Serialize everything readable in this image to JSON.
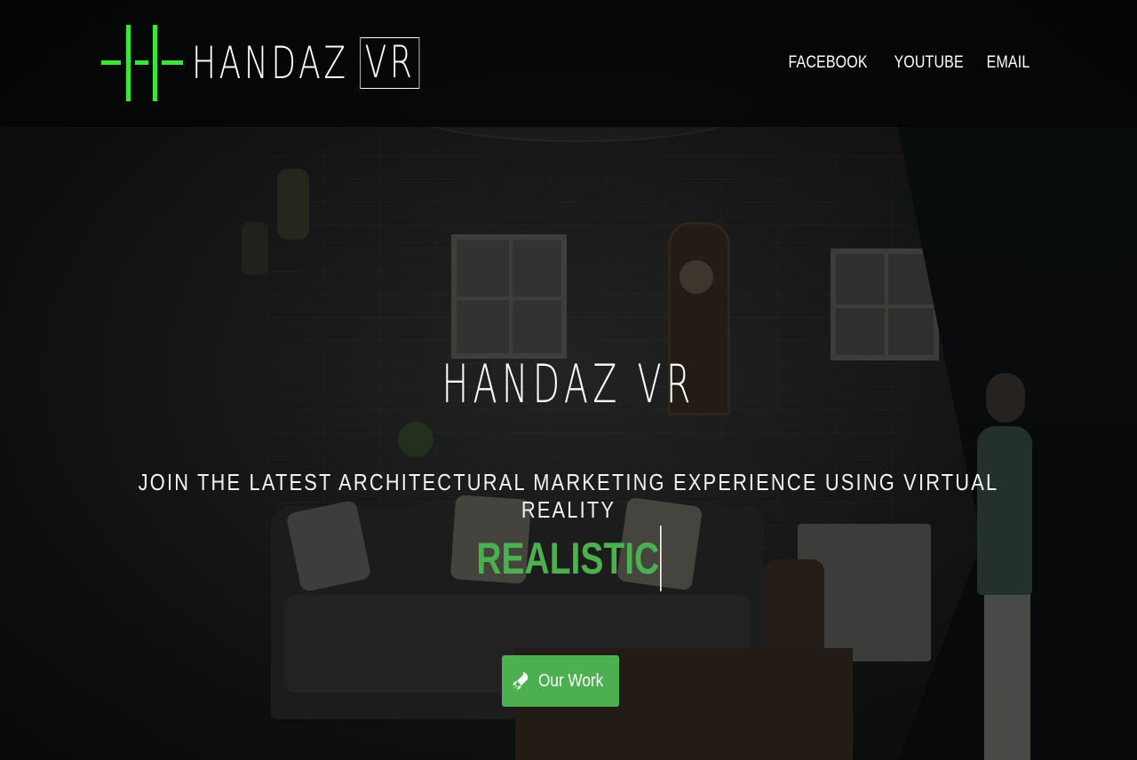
{
  "brand": {
    "name": "HANDAZ",
    "suffix": "VR",
    "accent_color": "#39e639"
  },
  "nav": {
    "items": [
      {
        "label": "FACEBOOK"
      },
      {
        "label": "YOUTUBE"
      },
      {
        "label": "EMAIL"
      }
    ]
  },
  "hero": {
    "title": "HANDAZ VR",
    "tagline": "JOIN THE LATEST ARCHITECTURAL MARKETING EXPERIENCE USING VIRTUAL REALITY",
    "typed_word": "REALISTIC",
    "typed_color": "#4caf50",
    "cta": {
      "label": "Our Work",
      "icon": "rocket-icon",
      "color": "#4caf50"
    }
  }
}
